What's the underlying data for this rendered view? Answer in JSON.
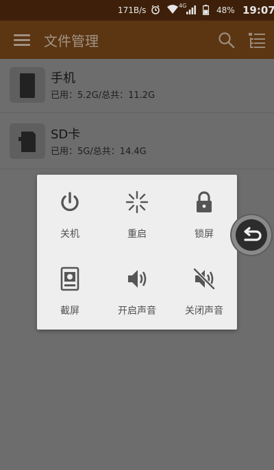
{
  "status_bar": {
    "net_speed": "171B/s",
    "network_type": "4G",
    "battery": "48%",
    "time": "19:07",
    "icons": [
      "alarm-icon",
      "wifi-icon",
      "signal-icon",
      "battery-icon"
    ]
  },
  "app_bar": {
    "title": "文件管理",
    "icons": [
      "menu-icon",
      "search-icon",
      "list-settings-icon"
    ]
  },
  "storage": [
    {
      "name": "手机",
      "detail": "已用：5.2G/总共：11.2G",
      "icon": "phone-icon"
    },
    {
      "name": "SD卡",
      "detail": "已用：5G/总共：14.4G",
      "icon": "sd-card-icon"
    }
  ],
  "power_menu": {
    "actions": [
      {
        "label": "关机",
        "icon": "power-icon"
      },
      {
        "label": "重启",
        "icon": "restart-icon"
      },
      {
        "label": "锁屏",
        "icon": "lock-icon"
      },
      {
        "label": "截屏",
        "icon": "screenshot-icon"
      },
      {
        "label": "开启声音",
        "icon": "volume-on-icon"
      },
      {
        "label": "关闭声音",
        "icon": "volume-off-icon"
      }
    ]
  },
  "floating_button": {
    "icon": "back-icon"
  }
}
